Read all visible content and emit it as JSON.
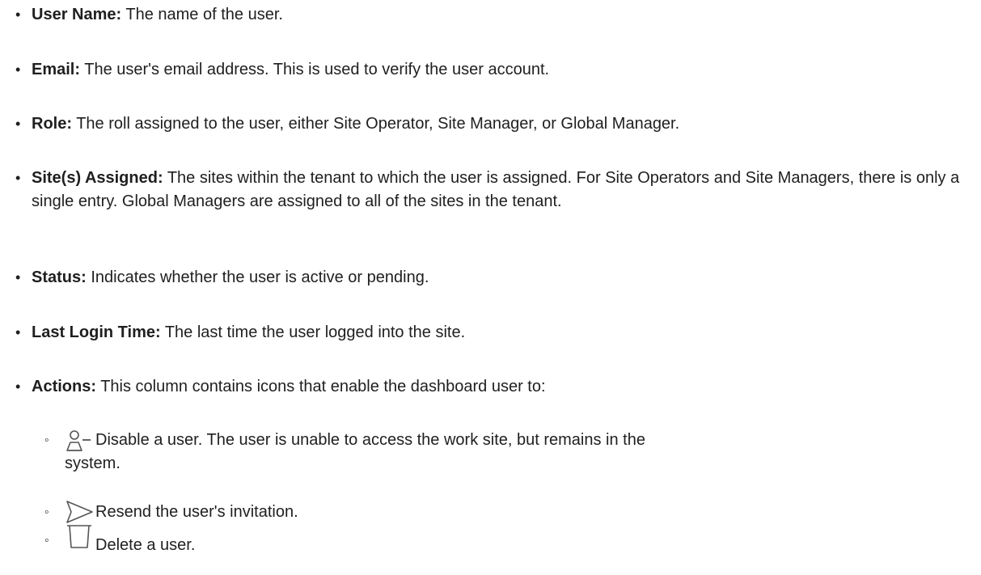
{
  "fields": [
    {
      "term": "User Name:",
      "desc": " The name of the user."
    },
    {
      "term": "Email:",
      "desc": " The user's email address. This is used to verify the user account."
    },
    {
      "term": "Role:",
      "desc": " The roll assigned to the user, either Site Operator, Site Manager, or Global Manager."
    },
    {
      "term": "Site(s) Assigned:",
      "desc": " The sites within the tenant to which the user is assigned. For Site Operators and Site Managers, there is only a single entry. Global Managers are assigned to all of the sites in the tenant."
    },
    {
      "term": "Status:",
      "desc": " Indicates whether the user is active or pending."
    },
    {
      "term": "Last Login Time:",
      "desc": " The last time the user logged into the site."
    },
    {
      "term": "Actions:",
      "desc": " This column contains icons that enable the dashboard user to:"
    }
  ],
  "actions": [
    {
      "icon": "disable-user-icon",
      "line1": "Disable a user. The user is unable to access the work site, but remains in the",
      "line2": "system."
    },
    {
      "icon": "send-icon",
      "text": "Resend the user's invitation."
    },
    {
      "icon": "trash-icon",
      "text": "Delete a user."
    }
  ],
  "colors": {
    "text": "#1f1f1f",
    "icon": "#555555"
  }
}
